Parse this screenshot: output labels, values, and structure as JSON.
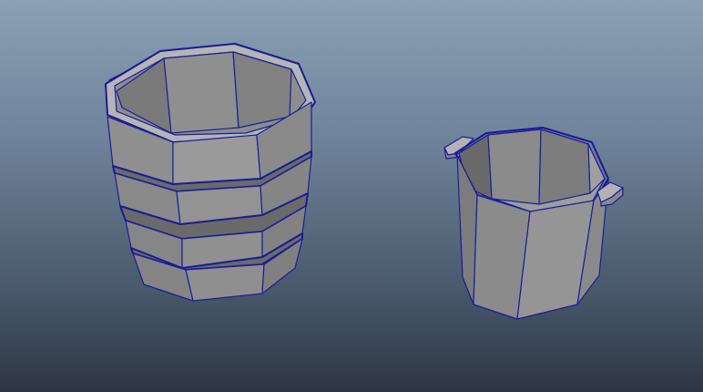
{
  "viewport": {
    "background_top": "#8b9fb5",
    "background_bottom": "#2d3644",
    "wireframe_color": "#1c1c9c",
    "shaded_color": "#8a8a8a"
  },
  "scene": {
    "objects": [
      {
        "name": "banded-bucket",
        "kind": "octagonal bucket with three bands"
      },
      {
        "name": "handled-pot",
        "kind": "octagonal pot with two side handles"
      }
    ]
  }
}
